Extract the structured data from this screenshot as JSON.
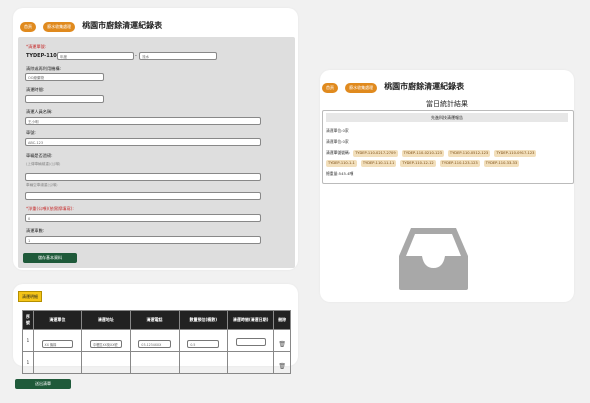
{
  "form_panel": {
    "back_pill": "首頁",
    "menu_pill": "廢水收集處理",
    "title": "桃園市廚餘清運紀錄表",
    "fields": {
      "clearance_no_label": "*清運單號:",
      "clearance_no_prefix": "TYDEP-110-",
      "clearance_no_placeholder": "年度",
      "clearance_no_placeholder2": "流水",
      "facility_label": "清除或再利用機構:",
      "facility_placeholder": "OO廢棄物",
      "time_label": "清運時間:",
      "personnel_label": "清運人員名稱:",
      "personnel_placeholder": "王小明",
      "vehicle_label": "車號:",
      "vehicle_placeholder": "ABC-123",
      "weigh_label": "車輛是否過磅:",
      "weigh_note1": "(上傳車輛總重)(公噸)",
      "weigh_note2": "車輛空車總重(公噸)",
      "weight_label": "*淨重(公噸)(依實際填寫):",
      "weight_placeholder": "0",
      "count_label": "清運車數:",
      "count_placeholder": "1",
      "save_button": "儲存基本資料"
    }
  },
  "detail_panel": {
    "tag": "清運明細",
    "headers": [
      "序號",
      "清運單位",
      "清運地址",
      "清運電話",
      "數量預估(桶數)",
      "清運時間(清運日期)",
      "刪除"
    ],
    "rows": [
      {
        "no": "1",
        "unit": "XX 機構",
        "address": "中壢區XX街XX號",
        "phone": "03-1234XXX",
        "count": "0.5",
        "time": ""
      },
      {
        "no": "1",
        "unit": "",
        "address": "",
        "phone": "",
        "count": "",
        "time": ""
      }
    ],
    "submit_button": "送出清單"
  },
  "summary_panel": {
    "back_pill": "首頁",
    "menu_pill": "廢水收集處理",
    "title": "桃園市廚餘清運紀錄表",
    "subtitle": "當日統計結果",
    "box_header": "先進科技清運報告",
    "line1": "清運單位:0家",
    "line2": "清運單位:0家",
    "line3_label": "清運單號號碼:",
    "chips": [
      "TYDEP-110-0217-2709",
      "TYDEP-110-0210-123",
      "TYDEP-110-0512-123",
      "TYDEP-110-0917-123",
      "TYDEP-110-1-1",
      "TYDEP-110-11-11",
      "TYDEP-110-12-12",
      "TYDEP-110-123-123",
      "TYDEP-110-33-33"
    ],
    "total": "總重量:545.4噸",
    "empty_icon": "inbox-tray-icon"
  }
}
